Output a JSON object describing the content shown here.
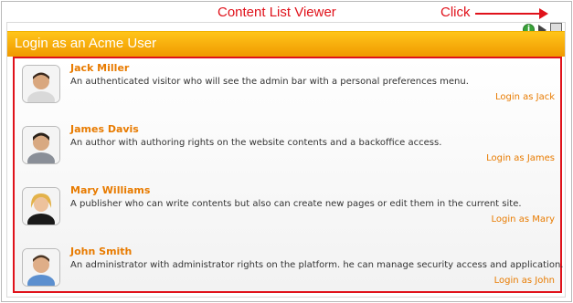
{
  "annotations": {
    "content_list_viewer": "Content List Viewer",
    "click": "Click"
  },
  "panel": {
    "title": "Login as an Acme User"
  },
  "users": [
    {
      "name": "Jack Miller",
      "description": "An authenticated visitor who will see the admin bar with a personal preferences menu.",
      "login_label": "Login as Jack"
    },
    {
      "name": "James Davis",
      "description": "An author with authoring rights on the website contents and a backoffice access.",
      "login_label": "Login as James"
    },
    {
      "name": "Mary Williams",
      "description": "A publisher who can write contents but also can create new pages or edit them in the current site.",
      "login_label": "Login as Mary"
    },
    {
      "name": "John Smith",
      "description": "An administrator with administrator rights on the platform. he can manage security access and application.",
      "login_label": "Login as John"
    }
  ],
  "colors": {
    "accent_orange": "#e87b00",
    "titlebar_top": "#ffc51a",
    "titlebar_bottom": "#f09900",
    "annotation_red": "#e0121b"
  },
  "icons": {
    "toolbar": [
      "info-icon",
      "play-icon",
      "settings-icon"
    ]
  }
}
